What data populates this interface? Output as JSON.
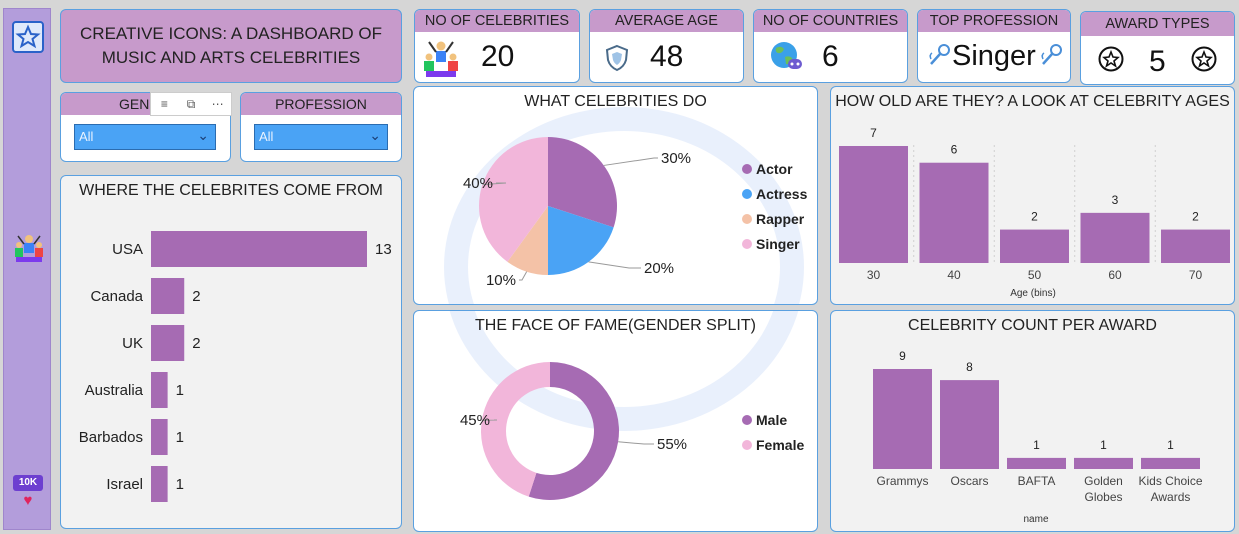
{
  "header": {
    "title": "CREATIVE ICONS: A DASHBOARD OF MUSIC AND ARTS CELEBRITIES"
  },
  "kpis": {
    "celebrities": {
      "label": "NO OF CELEBRITIES",
      "value": "20",
      "icon": "celebrity-group-icon"
    },
    "age": {
      "label": "AVERAGE AGE",
      "value": "48",
      "icon": "shield-icon"
    },
    "countries": {
      "label": "NO OF COUNTRIES",
      "value": "6",
      "icon": "globe-icon"
    },
    "profession": {
      "label": "TOP PROFESSION",
      "value": "Singer",
      "icon": "microphone-icon"
    },
    "awards": {
      "label": "AWARD TYPES",
      "value": "5",
      "icon": "star-badge-icon"
    }
  },
  "slicers": {
    "gender": {
      "label": "GENDER",
      "visible_label": "GENI",
      "value": "All"
    },
    "profession": {
      "label": "PROFESSION",
      "value": "All"
    }
  },
  "sidebar": {
    "badge": "10K"
  },
  "colors": {
    "purple": "#a66bb3",
    "blue": "#4aa3f5",
    "peach": "#f4c2a7",
    "pink": "#f2b6da",
    "header": "#c79acb",
    "border": "#5aa0e0"
  },
  "chart_data": [
    {
      "id": "countries",
      "type": "bar",
      "orientation": "horizontal",
      "title": "WHERE THE CELEBRITES COME FROM",
      "categories": [
        "USA",
        "Canada",
        "UK",
        "Australia",
        "Barbados",
        "Israel"
      ],
      "values": [
        13,
        2,
        2,
        1,
        1,
        1
      ],
      "labels": [
        "13",
        "2",
        "2",
        "1",
        "1",
        "1"
      ]
    },
    {
      "id": "profession",
      "type": "pie",
      "title": "WHAT CELEBRITIES DO",
      "categories": [
        "Actor",
        "Actress",
        "Rapper",
        "Singer"
      ],
      "values": [
        30,
        20,
        10,
        40
      ],
      "labels": [
        "30%",
        "20%",
        "10%",
        "40%"
      ],
      "colors": [
        "#a66bb3",
        "#4aa3f5",
        "#f4c2a7",
        "#f2b6da"
      ]
    },
    {
      "id": "gender",
      "type": "pie",
      "variant": "donut",
      "title": "THE FACE OF FAME(GENDER SPLIT)",
      "categories": [
        "Male",
        "Female"
      ],
      "values": [
        55,
        45
      ],
      "labels": [
        "55%",
        "45%"
      ],
      "colors": [
        "#a66bb3",
        "#f2b6da"
      ]
    },
    {
      "id": "ages",
      "type": "bar",
      "title": "HOW OLD ARE THEY? A LOOK AT CELEBRITY AGES",
      "categories": [
        "30",
        "40",
        "50",
        "60",
        "70"
      ],
      "values": [
        7,
        6,
        2,
        3,
        2
      ],
      "labels": [
        "7",
        "6",
        "2",
        "3",
        "2"
      ],
      "xlabel": "Age (bins)"
    },
    {
      "id": "awards",
      "type": "bar",
      "title": "CELEBRITY COUNT PER AWARD",
      "categories": [
        "Grammys",
        "Oscars",
        "BAFTA",
        "Golden Globes",
        "Kids Choice Awards"
      ],
      "category_lines": [
        [
          "Grammys"
        ],
        [
          "Oscars"
        ],
        [
          "BAFTA"
        ],
        [
          "Golden",
          "Globes"
        ],
        [
          "Kids Choice",
          "Awards"
        ]
      ],
      "values": [
        9,
        8,
        1,
        1,
        1
      ],
      "labels": [
        "9",
        "8",
        "1",
        "1",
        "1"
      ],
      "xlabel": "name"
    }
  ]
}
